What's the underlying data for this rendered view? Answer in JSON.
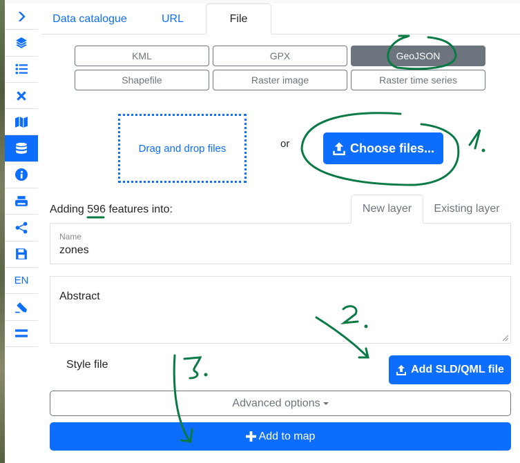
{
  "sidebar": {
    "items": [
      {
        "icon": "chevron-right-icon"
      },
      {
        "icon": "layers-icon"
      },
      {
        "icon": "list-icon"
      },
      {
        "icon": "tools-icon"
      },
      {
        "icon": "map-icon"
      },
      {
        "icon": "database-icon",
        "active": true
      },
      {
        "icon": "info-icon"
      },
      {
        "icon": "print-icon"
      },
      {
        "icon": "share-icon"
      },
      {
        "icon": "save-icon"
      },
      {
        "icon": "language",
        "label": "EN"
      },
      {
        "icon": "pencil-icon"
      },
      {
        "icon": "menu-icon"
      }
    ]
  },
  "tabs": [
    {
      "label": "Data catalogue"
    },
    {
      "label": "URL"
    },
    {
      "label": "File",
      "active": true
    }
  ],
  "formats": [
    "KML",
    "GPX",
    "GeoJSON",
    "Shapefile",
    "Raster image",
    "Raster time series"
  ],
  "selected_format": "GeoJSON",
  "upload": {
    "drop_label": "Drag and drop files",
    "or_label": "or",
    "choose_label": "Choose files..."
  },
  "adding": {
    "prefix": "Adding",
    "count": "596",
    "suffix": "features into:"
  },
  "layer_tabs": [
    {
      "label": "New layer",
      "active": true
    },
    {
      "label": "Existing layer"
    }
  ],
  "name_field": {
    "label": "Name",
    "value": "zones"
  },
  "abstract_field": {
    "placeholder": "Abstract"
  },
  "style": {
    "label": "Style file",
    "button": "Add SLD/QML file"
  },
  "advanced_label": "Advanced options",
  "add_to_map_label": "Add to map",
  "colors": {
    "primary": "#0d6efd",
    "secondary": "#6c757d",
    "annotation": "#0a7a45"
  }
}
